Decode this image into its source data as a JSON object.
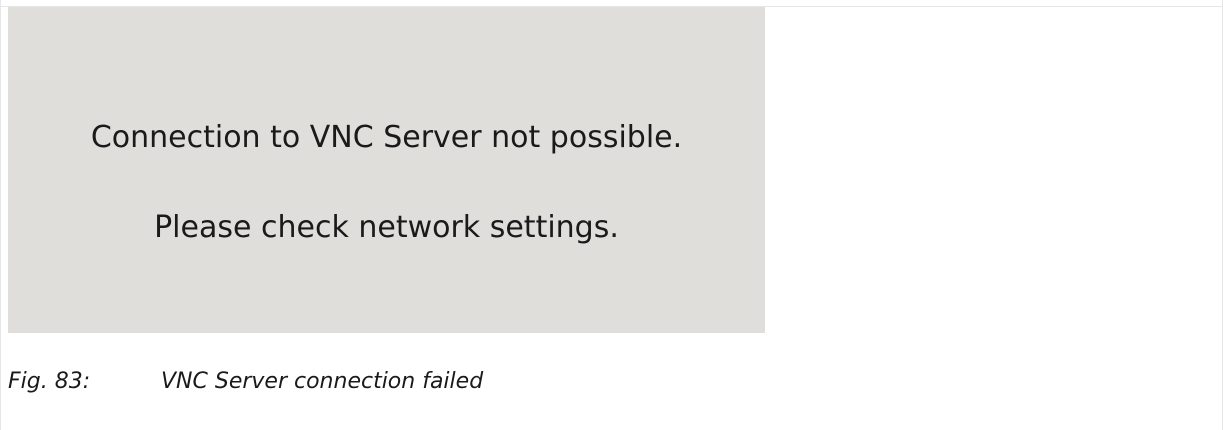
{
  "figure": {
    "screen": {
      "message_line1": "Connection to VNC Server not possible.",
      "message_line2": "Please check network settings."
    },
    "caption": {
      "label": "Fig. 83:",
      "text": "VNC Server connection failed"
    }
  }
}
